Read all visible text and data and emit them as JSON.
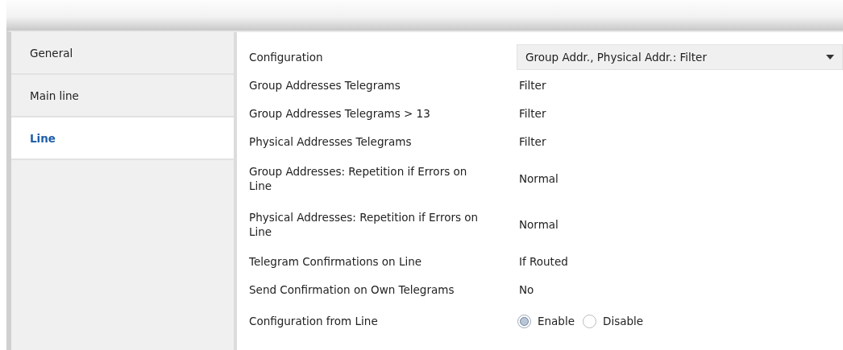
{
  "sidebar": {
    "items": [
      {
        "label": "General",
        "selected": false
      },
      {
        "label": "Main line",
        "selected": false
      },
      {
        "label": "Line",
        "selected": true
      }
    ]
  },
  "parameters": [
    {
      "kind": "dropdown",
      "label": "Configuration",
      "value": "Group Addr., Physical Addr.: Filter"
    },
    {
      "kind": "text",
      "label": "Group Addresses Telegrams",
      "value": "Filter"
    },
    {
      "kind": "text",
      "label": "Group Addresses Telegrams > 13",
      "value": "Filter"
    },
    {
      "kind": "text",
      "label": "Physical Addresses Telegrams",
      "value": "Filter"
    },
    {
      "kind": "text",
      "label": "Group Addresses: Repetition if Errors on Line",
      "value": "Normal"
    },
    {
      "kind": "text",
      "label": "Physical Addresses: Repetition if Errors on Line",
      "value": "Normal"
    },
    {
      "kind": "text",
      "label": "Telegram Confirmations on Line",
      "value": "If Routed"
    },
    {
      "kind": "text",
      "label": "Send Confirmation on Own Telegrams",
      "value": "No"
    },
    {
      "kind": "radio",
      "label": "Configuration from Line",
      "options": [
        {
          "label": "Enable",
          "selected": true
        },
        {
          "label": "Disable",
          "selected": false
        }
      ]
    }
  ]
}
